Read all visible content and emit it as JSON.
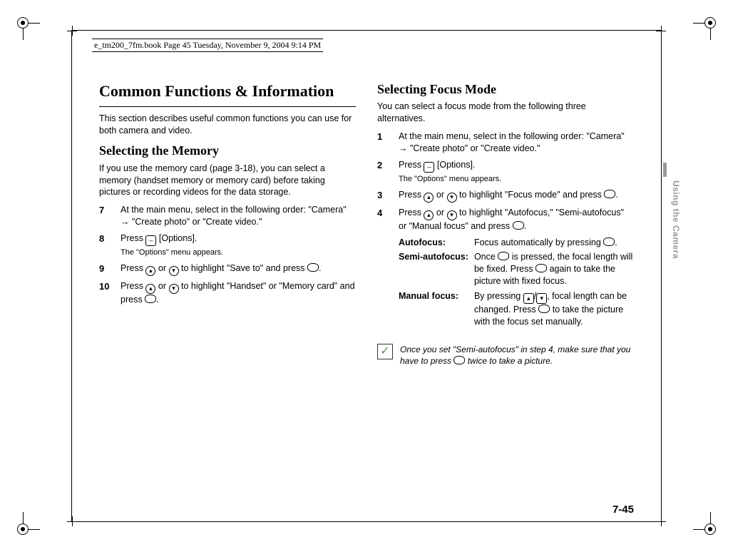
{
  "header": "e_tm200_7fm.book  Page 45  Tuesday, November 9, 2004  9:14 PM",
  "side_tab": "Using the Camera",
  "page_number": "7-45",
  "left": {
    "title": "Common Functions & Information",
    "intro": "This section describes useful common functions you can use for both camera and video.",
    "sub_title": "Selecting the Memory",
    "sub_intro": "If you use the memory card (page 3-18), you can select a memory (handset memory or memory card) before taking pictures or recording videos for the data storage.",
    "steps": [
      {
        "num": "7",
        "text": "At the main menu, select in the following order: \"Camera\" → \"Create photo\" or \"Create video.\""
      },
      {
        "num": "8",
        "text_a": "Press ",
        "text_b": " [Options].",
        "note": "The \"Options\" menu appears."
      },
      {
        "num": "9",
        "text_a": "Press ",
        "text_b": " or ",
        "text_c": " to highlight \"Save to\" and press ",
        "text_d": "."
      },
      {
        "num": "10",
        "text_a": "Press ",
        "text_b": " or ",
        "text_c": " to highlight \"Handset\" or \"Memory card\" and press ",
        "text_d": "."
      }
    ]
  },
  "right": {
    "title": "Selecting Focus Mode",
    "intro": "You can select a focus mode from the following three alternatives.",
    "steps": [
      {
        "num": "1",
        "text": "At the main menu, select in the following order: \"Camera\" → \"Create photo\" or \"Create video.\""
      },
      {
        "num": "2",
        "text_a": "Press ",
        "text_b": " [Options].",
        "note": "The \"Options\" menu appears."
      },
      {
        "num": "3",
        "text_a": "Press ",
        "text_b": " or ",
        "text_c": " to highlight \"Focus mode\" and press ",
        "text_d": "."
      },
      {
        "num": "4",
        "text_a": "Press ",
        "text_b": " or ",
        "text_c": " to highlight \"Autofocus,\" \"Semi-autofocus\" or \"Manual focus\" and press ",
        "text_d": "."
      }
    ],
    "defs": [
      {
        "term": "Autofocus:",
        "desc_a": "Focus automatically by pressing ",
        "desc_b": "."
      },
      {
        "term": "Semi-autofocus:",
        "desc_a": "Once ",
        "desc_b": " is pressed, the focal length will be fixed. Press ",
        "desc_c": " again to take the picture with fixed focus."
      },
      {
        "term": "Manual focus:",
        "desc_a": "By pressing ",
        "desc_b": "/",
        "desc_c": ", focal length can be changed. Press ",
        "desc_d": " to take the picture with the focus set manually."
      }
    ],
    "note": "Once you set \"Semi-autofocus\" in step 4, make sure that you have to press        twice to take a picture.",
    "note_a": "Once you set \"Semi-autofocus\" in step 4, make sure that you have to press ",
    "note_b": " twice to take a picture."
  }
}
